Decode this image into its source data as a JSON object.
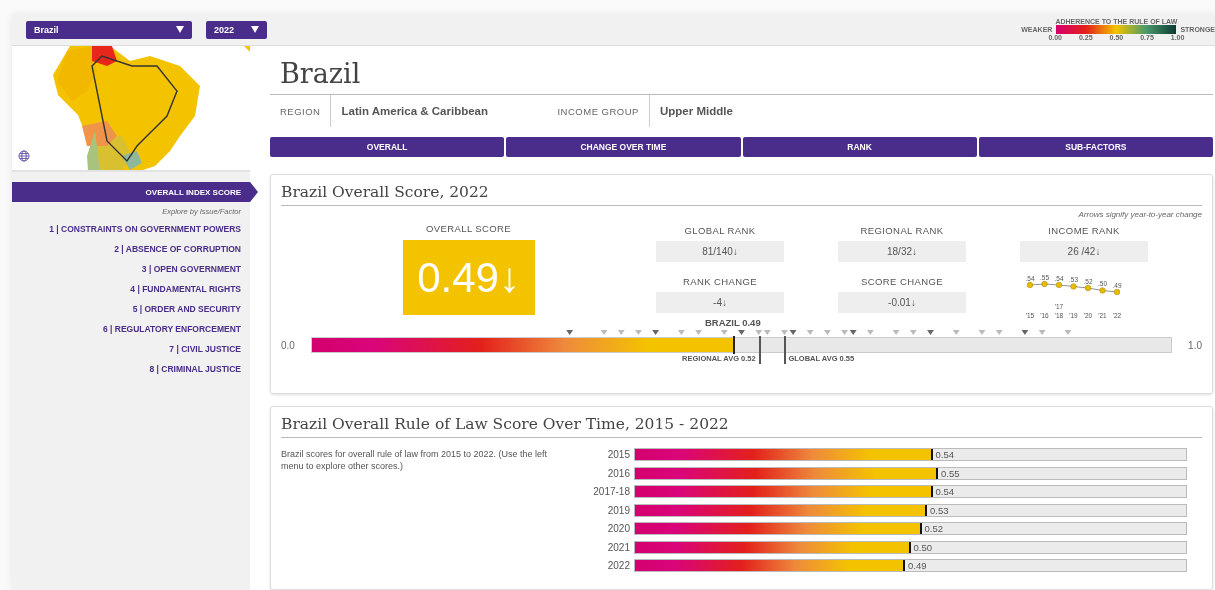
{
  "filters": [
    {
      "label": "Brazil",
      "kind": "wide"
    },
    {
      "label": "2022",
      "kind": "narrow"
    }
  ],
  "legend": {
    "title": "ADHERENCE TO THE RULE OF LAW",
    "low": "WEAKER",
    "high": "STRONGE",
    "ticks": [
      "0.00",
      "0.25",
      "0.50",
      "0.75",
      "1.00"
    ]
  },
  "sidebar": {
    "heading": {
      "label": "OVERALL INDEX SCORE",
      "selected": true
    },
    "hint": "Explore by Issue/Factor",
    "items": [
      {
        "label": "1 | CONSTRAINTS ON GOVERNMENT POWERS",
        "selected": false
      },
      {
        "label": "2 | ABSENCE OF CORRUPTION",
        "selected": false
      },
      {
        "label": "3 | OPEN GOVERNMENT",
        "selected": false
      },
      {
        "label": "4 | FUNDAMENTAL RIGHTS",
        "selected": false
      },
      {
        "label": "5 | ORDER AND SECURITY",
        "selected": false
      },
      {
        "label": "6 | REGULATORY ENFORCEMENT",
        "selected": false
      },
      {
        "label": "7 | CIVIL JUSTICE",
        "selected": false
      },
      {
        "label": "8 | CRIMINAL JUSTICE",
        "selected": false
      }
    ]
  },
  "country": "Brazil",
  "info": [
    {
      "label": "REGION",
      "value": "Latin America & Caribbean"
    },
    {
      "label": "INCOME GROUP",
      "value": "Upper Middle"
    }
  ],
  "tabs": [
    {
      "label": "OVERALL",
      "selected": false
    },
    {
      "label": "CHANGE OVER TIME",
      "selected": false
    },
    {
      "label": "RANK",
      "selected": false
    },
    {
      "label": "SUB-FACTORS",
      "selected": false
    }
  ],
  "score_card": {
    "title": "Brazil Overall Score, 2022",
    "note": "Arrows signify year-to-year change",
    "overall": {
      "label": "OVERALL SCORE",
      "value": "0.49↓"
    },
    "stats": [
      {
        "label": "GLOBAL RANK",
        "value": "81/140↓"
      },
      {
        "label": "REGIONAL RANK",
        "value": "18/32↓"
      },
      {
        "label": "INCOME RANK",
        "value": "26 /42↓"
      },
      {
        "label": "RANK CHANGE",
        "value": "-4↓"
      },
      {
        "label": "SCORE CHANGE",
        "value": "-0.01↓"
      }
    ],
    "trend": {
      "points": [
        {
          "label": ".54",
          "year": "'15"
        },
        {
          "label": ".55",
          "year": "'16"
        },
        {
          "label": ".54",
          "year": "'18",
          "year_above": "'17"
        },
        {
          "label": ".53",
          "year": "'19"
        },
        {
          "label": ".52",
          "year": "'20"
        },
        {
          "label": ".50",
          "year": "'21"
        },
        {
          "label": ".49",
          "year": "'22"
        }
      ]
    },
    "scale": {
      "min": "0.0",
      "max": "1.0",
      "marker": {
        "label": "BRAZIL 0.49",
        "level": 0.49
      },
      "averages": [
        {
          "label": "REGIONAL AVG 0.52",
          "level": 0.52
        },
        {
          "label": "GLOBAL AVG 0.55",
          "level": 0.55
        }
      ]
    }
  },
  "time_card": {
    "title": "Brazil Overall Rule of Law Score Over Time, 2015 - 2022",
    "description": "Brazil scores for overall rule of law from 2015 to 2022. (Use the left menu to explore other scores.)",
    "rows": [
      {
        "label": "2015",
        "level": 0.54,
        "reading": "0.54"
      },
      {
        "label": "2016",
        "level": 0.55,
        "reading": "0.55"
      },
      {
        "label": "2017-18",
        "level": 0.54,
        "reading": "0.54"
      },
      {
        "label": "2019",
        "level": 0.53,
        "reading": "0.53"
      },
      {
        "label": "2020",
        "level": 0.52,
        "reading": "0.52"
      },
      {
        "label": "2021",
        "level": 0.5,
        "reading": "0.50"
      },
      {
        "label": "2022",
        "level": 0.49,
        "reading": "0.49"
      }
    ]
  }
}
